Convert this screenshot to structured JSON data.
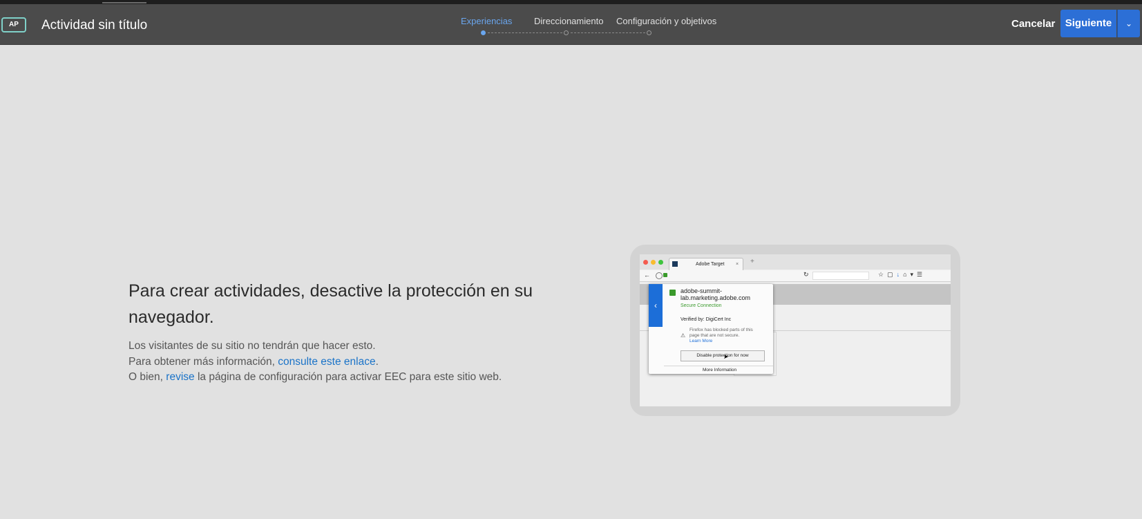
{
  "app": {
    "badge": "AP",
    "title": "Actividad sin título"
  },
  "steps": [
    {
      "label": "Experiencias",
      "active": true
    },
    {
      "label": "Direccionamiento",
      "active": false
    },
    {
      "label": "Configuración y objetivos",
      "active": false
    }
  ],
  "actions": {
    "cancel": "Cancelar",
    "next": "Siguiente"
  },
  "message": {
    "heading": "Para crear actividades, desactive la protección en su navegador.",
    "line1": "Los visitantes de su sitio no tendrán que hacer esto.",
    "line2_prefix": "Para obtener más información, ",
    "line2_link": "consulte este enlace",
    "line2_suffix": ".",
    "line3_prefix": "O bien, ",
    "line3_link": "revise",
    "line3_suffix": " la página de configuración para activar EEC para este sitio web."
  },
  "illustration": {
    "tab_title": "Adobe Target",
    "popup_domain": "adobe-summit-lab.marketing.adobe.com",
    "popup_domain_line1": "adobe-summit-",
    "popup_domain_line2": "lab.marketing.adobe.com",
    "secure": "Secure Connection",
    "verified": "Verified by: DigiCert Inc",
    "warning_line1": "Firefox has blocked parts of this",
    "warning_line2": "page that are not secure.",
    "learn_more": "Learn More",
    "disable_button": "Disable protection for now",
    "more_info": "More Information"
  },
  "colors": {
    "header_bg": "#4b4b4b",
    "accent": "#2c6fd6",
    "active_step": "#6aa6ee",
    "link": "#1a73c8",
    "page_bg": "#e1e1e1"
  }
}
